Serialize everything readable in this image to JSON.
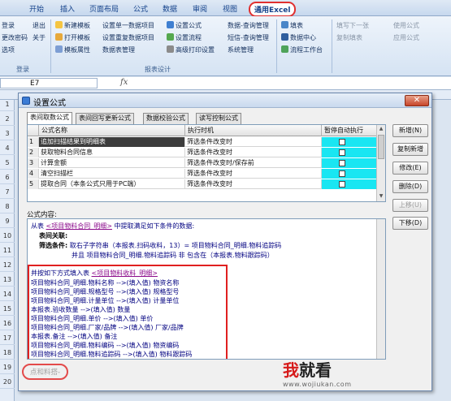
{
  "ribbon": {
    "tabs": [
      "开始",
      "插入",
      "页面布局",
      "公式",
      "数据",
      "审阅",
      "视图",
      "通用Excel"
    ],
    "active_tab": "通用Excel",
    "left_group": {
      "items": [
        "登录",
        "退出",
        "更改密码",
        "关于",
        "选项"
      ],
      "label": "登录"
    },
    "design_group": {
      "col1": [
        "新建模板",
        "打开模板",
        "模板属性"
      ],
      "col2": [
        "设置单一数据项目",
        "设置重复数据项目",
        "数据表管理"
      ],
      "col3": [
        "设置公式",
        "设置流程",
        "高级打印设置"
      ],
      "col4": [
        "数据-查询管理",
        "短信-查询管理",
        "系统管理"
      ],
      "label": "报表设计"
    },
    "data_group": {
      "items": [
        "填表",
        "数据中心",
        "流程工作台"
      ]
    },
    "right_group": {
      "items": [
        "填写下一张",
        "复制填表",
        "使用公式",
        "应用公式"
      ]
    }
  },
  "formula_bar": {
    "cell_ref": "E7",
    "fx": "fx"
  },
  "sheet": {
    "row_numbers": [
      "1",
      "2",
      "3",
      "4",
      "5",
      "6",
      "7",
      "8",
      "9",
      "10",
      "11",
      "12",
      "13",
      "14",
      "15",
      "16",
      "17",
      "18",
      "19",
      "20"
    ]
  },
  "dialog": {
    "title": "设置公式",
    "close": "✕",
    "tabs": [
      "表间取数公式",
      "表间回写更新公式",
      "数据校验公式",
      "读写控制公式"
    ],
    "active_tab": "表间取数公式",
    "columns": [
      "公式名称",
      "执行时机",
      "暂停自动执行"
    ],
    "rows": [
      {
        "num": "1",
        "name": "追加扫描结果到明细表",
        "timing": "筛选条件改变时",
        "selected": true
      },
      {
        "num": "2",
        "name": "获取物料合同信息",
        "timing": "筛选条件改变时"
      },
      {
        "num": "3",
        "name": "计算金额",
        "timing": "筛选条件改变时/保存前"
      },
      {
        "num": "4",
        "name": "清空扫描栏",
        "timing": "筛选条件改变时"
      },
      {
        "num": "5",
        "name": "提取合同（本条公式只用于PC端）",
        "timing": "筛选条件改变时"
      }
    ],
    "buttons": {
      "new": "新增(N)",
      "copy_new": "复制新增",
      "edit": "修改(E)",
      "delete": "删除(D)",
      "move_up": "上移(U)",
      "move_down": "下移(D)"
    },
    "content_label": "公式内容:",
    "content": {
      "line1_prefix": "从表",
      "line1_table": "<项目物料合同_明细>",
      "line1_suffix": "中提取满足如下条件的数据:",
      "line2": "表间关联:",
      "line3_label": "筛选条件:",
      "line3_text": "取右子字符串（本报表.扫码收料，13）= 项目物料合同_明细.物料追踪码",
      "line4": "并且 项目物料合同_明细.物料追踪码 非 包含在（本报表.物料跟踪码）",
      "line5_prefix": "并按如下方式填入表",
      "line5_table": "<项目物料收料_明细>",
      "mappings": [
        "项目物料合同_明细.物料名称 -->(填入值) 物资名称",
        "项目物料合同_明细.规格型号 -->(填入值) 规格型号",
        "项目物料合同_明细.计量单位 -->(填入值) 计量单位",
        "本报表.验收数量 -->(填入值) 数量",
        "项目物料合同_明细.单价 -->(填入值) 单价",
        "项目物料合同_明细.厂家/品牌 -->(填入值) 厂家/品牌",
        "本报表.备注 -->(填入值) 备注",
        "项目物料合同_明细.物料编码 -->(填入值) 物资编码",
        "项目物料合同_明细.物料追踪码 -->(填入值) 物料跟踪码"
      ]
    },
    "bottom_note": "点和料搭-"
  },
  "watermark": {
    "big_red": "我",
    "big_dark": "就看",
    "url": "www.wojiukan.com"
  }
}
